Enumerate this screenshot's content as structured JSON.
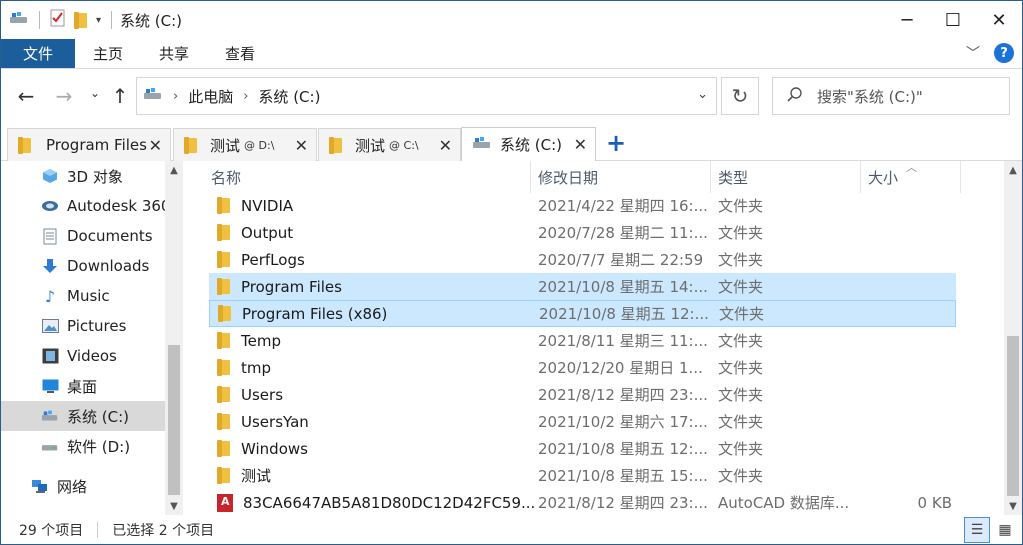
{
  "window": {
    "title": "系统 (C:)"
  },
  "ribbon": {
    "tabs": [
      "文件",
      "主页",
      "共享",
      "查看"
    ]
  },
  "address": {
    "crumbs": [
      "此电脑",
      "系统 (C:)"
    ],
    "search_placeholder": "搜索\"系统 (C:)\""
  },
  "tabs": [
    {
      "label": "Program Files",
      "suffix": ""
    },
    {
      "label": "测试",
      "suffix": "@ D:\\"
    },
    {
      "label": "测试",
      "suffix": "@ C:\\"
    },
    {
      "label": "系统 (C:)",
      "suffix": ""
    }
  ],
  "nav": [
    {
      "label": "3D 对象",
      "icon": "3d-objects-icon"
    },
    {
      "label": "Autodesk 360",
      "icon": "autodesk-360-icon"
    },
    {
      "label": "Documents",
      "icon": "documents-icon"
    },
    {
      "label": "Downloads",
      "icon": "downloads-icon"
    },
    {
      "label": "Music",
      "icon": "music-icon"
    },
    {
      "label": "Pictures",
      "icon": "pictures-icon"
    },
    {
      "label": "Videos",
      "icon": "videos-icon"
    },
    {
      "label": "桌面",
      "icon": "desktop-icon"
    },
    {
      "label": "系统 (C:)",
      "icon": "drive-c-icon",
      "selected": true
    },
    {
      "label": "软件 (D:)",
      "icon": "drive-d-icon"
    },
    {
      "label": "网络",
      "icon": "network-icon"
    }
  ],
  "columns": {
    "name": "名称",
    "date": "修改日期",
    "type": "类型",
    "size": "大小"
  },
  "files": [
    {
      "name": "NVIDIA",
      "date": "2021/4/22 星期四 16:...",
      "type": "文件夹",
      "size": ""
    },
    {
      "name": "Output",
      "date": "2020/7/28 星期二 11:...",
      "type": "文件夹",
      "size": ""
    },
    {
      "name": "PerfLogs",
      "date": "2020/7/7 星期二 22:59",
      "type": "文件夹",
      "size": ""
    },
    {
      "name": "Program Files",
      "date": "2021/10/8 星期五 14:...",
      "type": "文件夹",
      "size": "",
      "selected": true
    },
    {
      "name": "Program Files (x86)",
      "date": "2021/10/8 星期五 12:...",
      "type": "文件夹",
      "size": "",
      "selected": true,
      "focused": true
    },
    {
      "name": "Temp",
      "date": "2021/8/11 星期三 11:...",
      "type": "文件夹",
      "size": ""
    },
    {
      "name": "tmp",
      "date": "2020/12/20 星期日 1...",
      "type": "文件夹",
      "size": ""
    },
    {
      "name": "Users",
      "date": "2021/8/12 星期四 23:...",
      "type": "文件夹",
      "size": ""
    },
    {
      "name": "UsersYan",
      "date": "2021/10/2 星期六 17:...",
      "type": "文件夹",
      "size": ""
    },
    {
      "name": "Windows",
      "date": "2021/10/8 星期五 12:...",
      "type": "文件夹",
      "size": ""
    },
    {
      "name": "测试",
      "date": "2021/10/8 星期五 15:...",
      "type": "文件夹",
      "size": ""
    },
    {
      "name": "83CA6647AB5A81D80DC12D42FC59...",
      "date": "2021/8/12 星期四 23:...",
      "type": "AutoCAD 数据库...",
      "size": "0 KB",
      "kind": "autocad-file"
    }
  ],
  "status": {
    "count": "29 个项目",
    "selected": "已选择 2 个项目"
  }
}
